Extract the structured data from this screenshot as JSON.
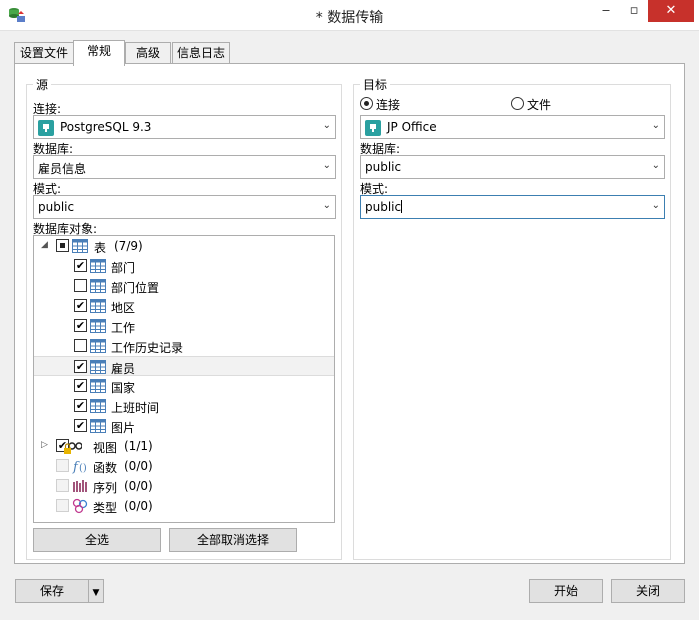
{
  "window": {
    "title": "* 数据传输",
    "min": "‒",
    "max": "▫",
    "close": "✕"
  },
  "tabs": [
    {
      "label": "设置文件"
    },
    {
      "label": "常规"
    },
    {
      "label": "高级"
    },
    {
      "label": "信息日志"
    }
  ],
  "source": {
    "group_title": "源",
    "connection_label": "连接:",
    "connection_value": "PostgreSQL 9.3",
    "database_label": "数据库:",
    "database_value": "雇员信息",
    "schema_label": "模式:",
    "schema_value": "public",
    "objects_label": "数据库对象:",
    "tree": {
      "tables": {
        "label": "表",
        "count": "(7/9)"
      },
      "table_items": [
        {
          "label": "部门",
          "checked": true
        },
        {
          "label": "部门位置",
          "checked": false
        },
        {
          "label": "地区",
          "checked": true
        },
        {
          "label": "工作",
          "checked": true
        },
        {
          "label": "工作历史记录",
          "checked": false
        },
        {
          "label": "雇员",
          "checked": true
        },
        {
          "label": "国家",
          "checked": true
        },
        {
          "label": "上班时间",
          "checked": true
        },
        {
          "label": "图片",
          "checked": true
        }
      ],
      "views": {
        "label": "视图",
        "count": "(1/1)"
      },
      "functions": {
        "label": "函数",
        "count": "(0/0)"
      },
      "sequences": {
        "label": "序列",
        "count": "(0/0)"
      },
      "types": {
        "label": "类型",
        "count": "(0/0)"
      }
    },
    "select_all": "全选",
    "deselect_all": "全部取消选择"
  },
  "target": {
    "group_title": "目标",
    "radio_connection": "连接",
    "radio_file": "文件",
    "connection_value": "JP Office",
    "database_label": "数据库:",
    "database_value": "public",
    "schema_label": "模式:",
    "schema_value": "public"
  },
  "footer": {
    "save": "保存",
    "start": "开始",
    "close": "关闭"
  }
}
